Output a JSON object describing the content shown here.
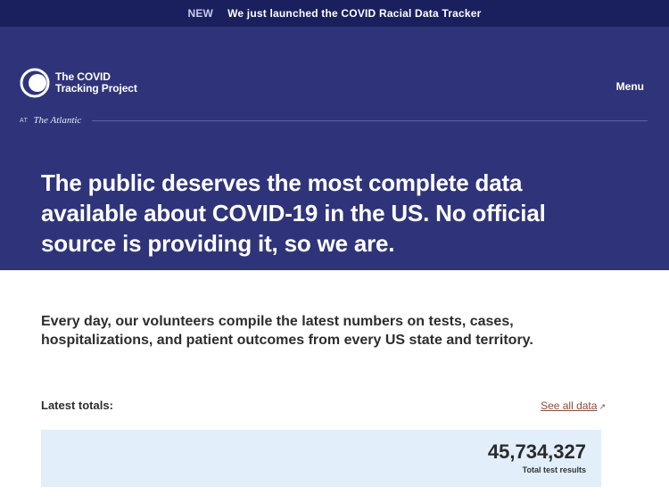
{
  "announcement": {
    "badge": "NEW",
    "text": "We just launched the COVID Racial Data Tracker"
  },
  "header": {
    "logo_line1": "The COVID",
    "logo_line2": "Tracking Project",
    "menu_label": "Menu",
    "at_label": "AT",
    "partner": "The Atlantic"
  },
  "hero": {
    "headline": "The public deserves the most complete data available about COVID-19 in the US. No official source is providing it, so we are."
  },
  "main": {
    "intro": "Every day, our volunteers compile the latest numbers on tests, cases, hospitalizations, and patient outcomes from every US state and territory.",
    "totals_label": "Latest totals:",
    "see_all_label": "See all data",
    "see_all_icon": "arrow-icon",
    "stats": [
      {
        "value": "45,734,327",
        "label": "Total test results"
      }
    ]
  },
  "colors": {
    "announce_bg": "#1a1f5e",
    "hero_bg": "#2f347a",
    "card_bg": "#e2eefa",
    "link": "#8a4b3d"
  }
}
